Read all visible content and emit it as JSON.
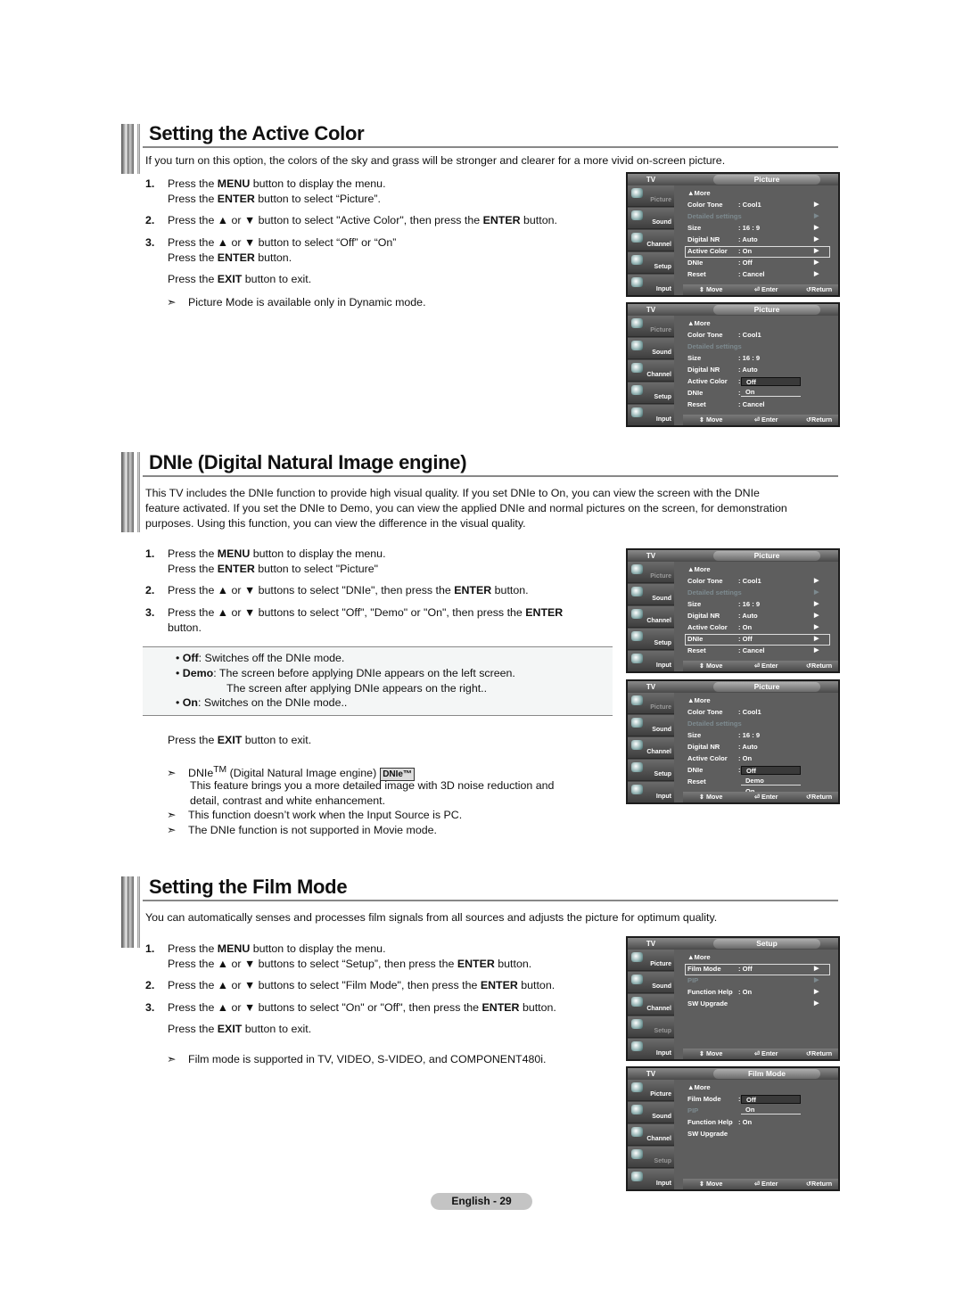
{
  "sections": [
    {
      "title": "Setting the Active Color",
      "intro": "If you turn on this option, the colors of the sky and grass will be stronger and clearer for a more vivid on-screen picture.",
      "steps": [
        {
          "num": "1.",
          "lines": [
            "Press the <b>MENU</b> button to display the menu.",
            "Press the <b>ENTER</b> button to select “Picture”."
          ]
        },
        {
          "num": "2.",
          "lines": [
            "Press the ▲ or ▼ button to select \"Active Color\", then press the <b>ENTER</b> button."
          ]
        },
        {
          "num": "3.",
          "lines": [
            "Press the ▲ or ▼ button to select “Off” or “On”",
            "Press the <b>ENTER</b> button."
          ]
        }
      ],
      "exit": "Press the <b>EXIT</b> button to exit.",
      "notes": [
        "Picture Mode is available only in Dynamic  mode."
      ]
    },
    {
      "title": "DNIe (Digital Natural Image engine)",
      "intro": "This TV includes the DNIe function to provide high visual quality. If you set DNIe to On, you can view the screen with the DNIe feature activated. If you set the DNIe to Demo, you can view the applied DNIe and normal pictures on the screen, for demonstration purposes. Using this function, you can view the difference in the visual quality.",
      "steps": [
        {
          "num": "1.",
          "lines": [
            "Press the <b>MENU</b> button to display the menu.",
            "Press the <b>ENTER</b> button to select \"Picture\""
          ]
        },
        {
          "num": "2.",
          "lines": [
            "Press the ▲ or ▼ buttons to select \"DNIe\", then press the <b>ENTER</b> button."
          ]
        },
        {
          "num": "3.",
          "lines": [
            "Press the ▲ or ▼ buttons to select \"Off\", \"Demo\" or \"On\", then press the <b>ENTER</b>",
            "button."
          ]
        }
      ],
      "options": [
        "• <b>Off</b>: Switches off the DNIe mode.",
        "• <b>Demo</b>: The screen before applying DNIe appears on the left screen.",
        "The screen after applying DNIe appears on the right..",
        "• <b>On</b>: Switches on the DNIe mode.."
      ],
      "exit": "Press the <b>EXIT</b> button to exit.",
      "notes": [
        "DNIe<sup>TM</sup> (Digital Natural Image engine)",
        "This feature brings you a more detailed image with 3D noise reduction and",
        "detail, contrast and white enhancement.",
        "This function doesn’t work when the Input Source is PC.",
        "The DNIe function is not supported in Movie mode."
      ],
      "logo": "DNIe™"
    },
    {
      "title": "Setting the Film Mode",
      "intro": "You can automatically senses and processes film signals from all sources and adjusts the picture for optimum quality.",
      "steps": [
        {
          "num": "1.",
          "lines": [
            "Press the <b>MENU</b> button to display the menu.",
            "Press the ▲ or ▼ buttons to select “Setup”, then press the <b>ENTER</b> button."
          ]
        },
        {
          "num": "2.",
          "lines": [
            "Press the ▲ or ▼ buttons to select \"Film Mode\", then press the <b>ENTER</b> button."
          ]
        },
        {
          "num": "3.",
          "lines": [
            "Press the ▲ or ▼ buttons to select \"On\" or \"Off\", then press the <b>ENTER</b> button."
          ]
        }
      ],
      "exit": "Press the <b>EXIT</b> button to exit.",
      "notes": [
        "Film mode is supported in TV, VIDEO, S-VIDEO, and COMPONENT480i."
      ]
    }
  ],
  "osd_common": {
    "tv": "TV",
    "side": [
      "Picture",
      "Sound",
      "Channel",
      "Setup",
      "Input"
    ],
    "footer": {
      "move": "Move",
      "enter": "Enter",
      "return": "Return"
    },
    "move_icon": "updown-arrow-icon",
    "enter_icon": "enter-icon",
    "return_icon": "return-icon"
  },
  "osd_picture_rows": [
    {
      "k": "▲More",
      "v": ""
    },
    {
      "k": "Color Tone",
      "v": ": Cool1"
    },
    {
      "k": "Detailed settings",
      "v": "",
      "dim": true
    },
    {
      "k": "Size",
      "v": ": 16 : 9"
    },
    {
      "k": "Digital NR",
      "v": ": Auto"
    },
    {
      "k": "Active Color",
      "v": ": On"
    },
    {
      "k": "DNIe",
      "v": ": Off"
    },
    {
      "k": "Reset",
      "v": ": Cancel"
    }
  ],
  "osd_setup_rows": [
    {
      "k": "▲More",
      "v": ""
    },
    {
      "k": "Film Mode",
      "v": ": Off"
    },
    {
      "k": "PIP",
      "v": "",
      "dim": true
    },
    {
      "k": "Function Help",
      "v": ": On"
    },
    {
      "k": "SW Upgrade",
      "v": ""
    }
  ],
  "osd_screens": [
    {
      "title": "Picture",
      "active_side": "Picture",
      "highlight": "Active Color"
    },
    {
      "title": "Picture",
      "active_side": "Picture",
      "dropdown_for": "Active Color",
      "options": [
        "Off",
        "On"
      ]
    },
    {
      "title": "Picture",
      "active_side": "Picture",
      "highlight": "DNIe"
    },
    {
      "title": "Picture",
      "active_side": "Picture",
      "dropdown_for": "DNIe",
      "options": [
        "Off",
        "Demo",
        "On"
      ]
    },
    {
      "title": "Setup",
      "active_side": "Setup",
      "highlight": "Film Mode"
    },
    {
      "title": "Film Mode",
      "active_side": "Setup",
      "dropdown_for": "Film Mode",
      "options": [
        "Off",
        "On"
      ]
    }
  ],
  "footer": {
    "page_label": "English - 29"
  }
}
